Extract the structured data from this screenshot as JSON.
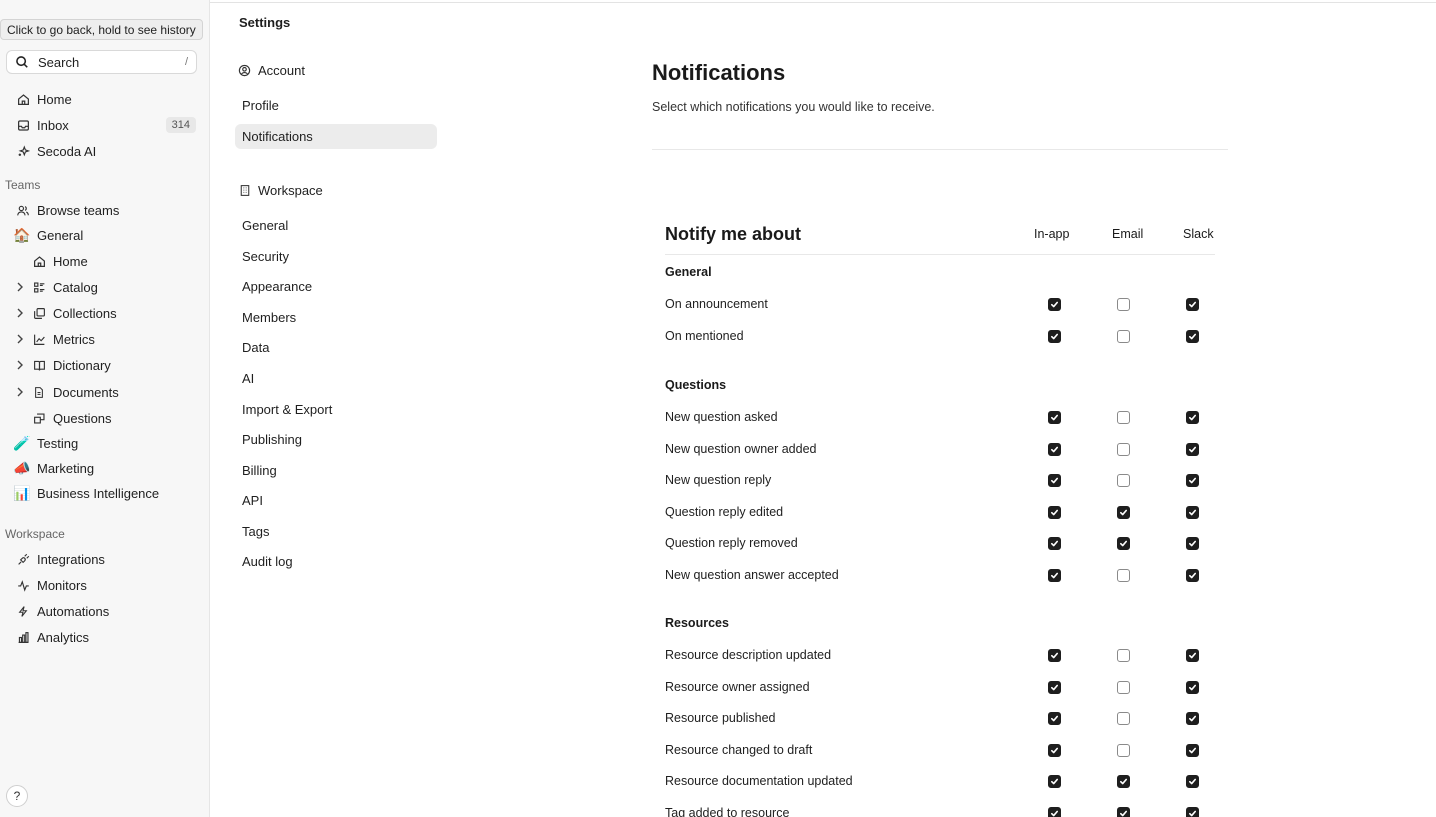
{
  "tooltip": "Click to go back, hold to see history",
  "search": {
    "label": "Search",
    "shortcut": "/"
  },
  "nav_top": [
    {
      "label": "Home",
      "icon": "home-icon"
    },
    {
      "label": "Inbox",
      "icon": "inbox-icon",
      "badge": "314"
    },
    {
      "label": "Secoda AI",
      "icon": "sparkle-icon"
    }
  ],
  "teams_label": "Teams",
  "teams": {
    "browse": "Browse teams",
    "general": "General",
    "general_emoji": "🏠",
    "home": "Home",
    "catalog": "Catalog",
    "collections": "Collections",
    "metrics": "Metrics",
    "dictionary": "Dictionary",
    "documents": "Documents",
    "questions": "Questions",
    "testing": "Testing",
    "testing_emoji": "🧪",
    "marketing": "Marketing",
    "marketing_emoji": "📣",
    "bi": "Business Intelligence",
    "bi_emoji": "📊"
  },
  "workspace_label": "Workspace",
  "workspace_nav": [
    "Integrations",
    "Monitors",
    "Automations",
    "Analytics"
  ],
  "help": "?",
  "settings": {
    "title": "Settings",
    "account_label": "Account",
    "account_items": [
      "Profile",
      "Notifications"
    ],
    "workspace_label": "Workspace",
    "workspace_items": [
      "General",
      "Security",
      "Appearance",
      "Members",
      "Data",
      "AI",
      "Import & Export",
      "Publishing",
      "Billing",
      "API",
      "Tags",
      "Audit log"
    ]
  },
  "main": {
    "title": "Notifications",
    "subtitle": "Select which notifications you would like to receive.",
    "table_title": "Notify me about",
    "columns": [
      "In-app",
      "Email",
      "Slack"
    ],
    "sections": [
      {
        "name": "General",
        "rows": [
          {
            "label": "On announcement",
            "inapp": true,
            "email": false,
            "slack": true
          },
          {
            "label": "On mentioned",
            "inapp": true,
            "email": false,
            "slack": true
          }
        ]
      },
      {
        "name": "Questions",
        "rows": [
          {
            "label": "New question asked",
            "inapp": true,
            "email": false,
            "slack": true
          },
          {
            "label": "New question owner added",
            "inapp": true,
            "email": false,
            "slack": true
          },
          {
            "label": "New question reply",
            "inapp": true,
            "email": false,
            "slack": true
          },
          {
            "label": "Question reply edited",
            "inapp": true,
            "email": true,
            "slack": true
          },
          {
            "label": "Question reply removed",
            "inapp": true,
            "email": true,
            "slack": true
          },
          {
            "label": "New question answer accepted",
            "inapp": true,
            "email": false,
            "slack": true
          }
        ]
      },
      {
        "name": "Resources",
        "rows": [
          {
            "label": "Resource description updated",
            "inapp": true,
            "email": false,
            "slack": true
          },
          {
            "label": "Resource owner assigned",
            "inapp": true,
            "email": false,
            "slack": true
          },
          {
            "label": "Resource published",
            "inapp": true,
            "email": false,
            "slack": true
          },
          {
            "label": "Resource changed to draft",
            "inapp": true,
            "email": false,
            "slack": true
          },
          {
            "label": "Resource documentation updated",
            "inapp": true,
            "email": true,
            "slack": true
          },
          {
            "label": "Tag added to resource",
            "inapp": true,
            "email": true,
            "slack": true
          }
        ]
      }
    ]
  }
}
